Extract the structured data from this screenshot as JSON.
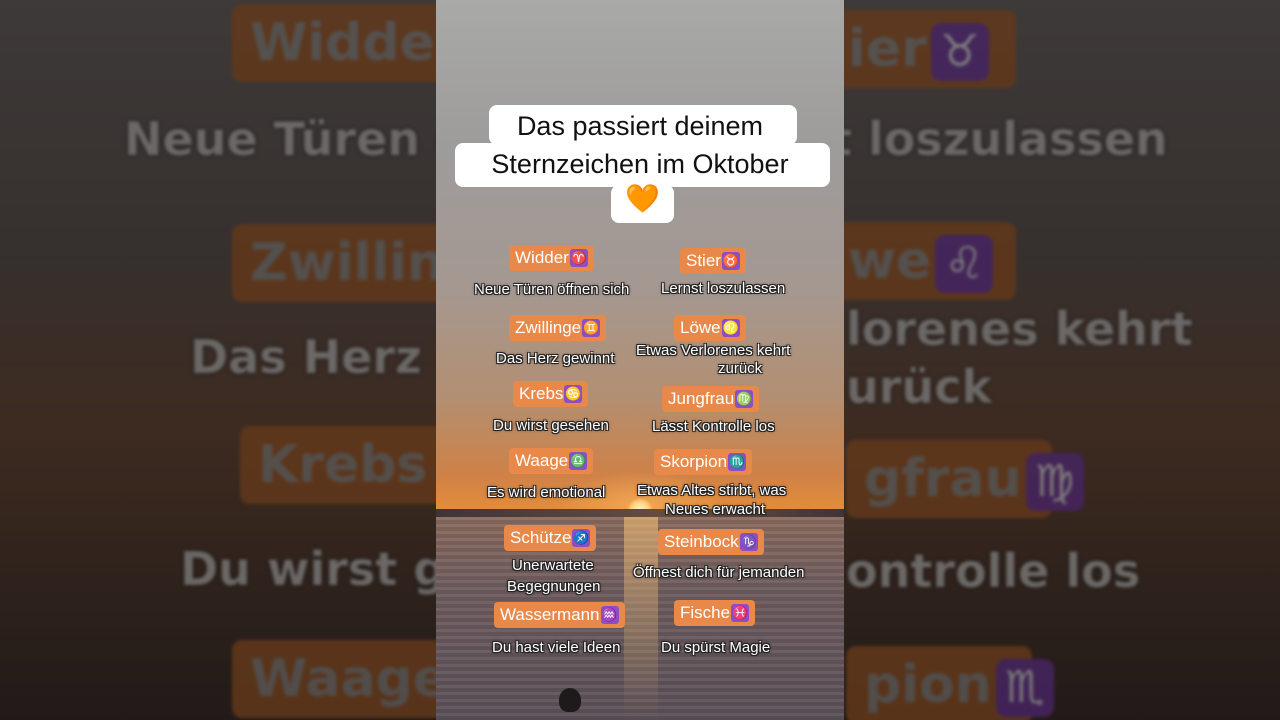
{
  "title": {
    "line1": "Das passiert deinem",
    "line2": "Sternzeichen im Oktober",
    "emoji": "🧡"
  },
  "signs": [
    {
      "name": "Widder",
      "symbol": "♈",
      "text": "Neue Türen öffnen sich"
    },
    {
      "name": "Stier",
      "symbol": "♉",
      "text": "Lernst loszulassen"
    },
    {
      "name": "Zwillinge",
      "symbol": "♊",
      "text": "Das Herz gewinnt"
    },
    {
      "name": "Löwe",
      "symbol": "♌",
      "text_lines": [
        "Etwas Verlorenes kehrt",
        "zurück"
      ]
    },
    {
      "name": "Krebs",
      "symbol": "♋",
      "text": "Du wirst gesehen"
    },
    {
      "name": "Jungfrau",
      "symbol": "♍",
      "text": "Lässt Kontrolle los"
    },
    {
      "name": "Waage",
      "symbol": "♎",
      "text": "Es wird emotional"
    },
    {
      "name": "Skorpion",
      "symbol": "♏",
      "text_lines": [
        "Etwas Altes stirbt, was",
        "Neues erwacht"
      ]
    },
    {
      "name": "Schütze",
      "symbol": "♐",
      "text_lines": [
        "Unerwartete",
        "Begegnungen"
      ]
    },
    {
      "name": "Steinbock",
      "symbol": "♑",
      "text": "Öffnest dich für jemanden"
    },
    {
      "name": "Wassermann",
      "symbol": "♒",
      "text": "Du hast viele Ideen"
    },
    {
      "name": "Fische",
      "symbol": "♓",
      "text": "Du spürst Magie"
    }
  ],
  "background_copy": {
    "tag_left_1": "Widder",
    "tag_right_1": "ier",
    "line_left_1": "Neue Türen öf",
    "line_right_1": "t loszulassen",
    "tag_left_2": "Zwilling",
    "tag_right_2": "we",
    "line_left_2": "Das Herz g",
    "line_right_2a": "lorenes kehrt",
    "line_right_2b": "urück",
    "tag_left_3": "Krebs",
    "tag_right_3": "gfrau",
    "line_left_3": "Du wirst ge",
    "line_right_3": "ontrolle los",
    "tag_left_4": "Waage",
    "tag_right_4": "pion"
  },
  "colors": {
    "tag_orange": "#e8894a",
    "symbol_purple": "#8a4fc4",
    "title_bg": "#ffffff"
  }
}
